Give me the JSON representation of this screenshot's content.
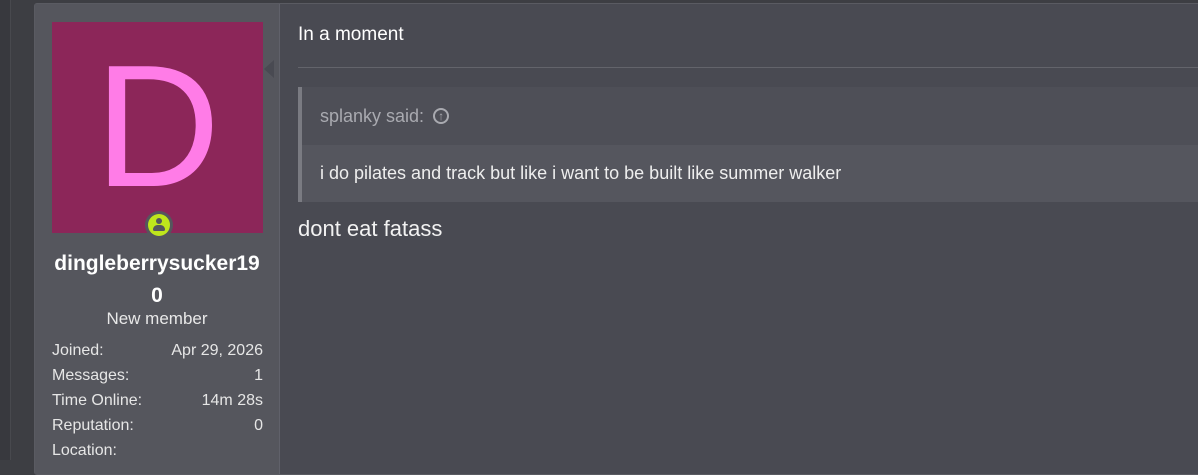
{
  "user": {
    "avatar_letter": "D",
    "username": "dingleberrysucker190",
    "title": "New member",
    "stats": [
      {
        "label": "Joined:",
        "value": "Apr 29, 2026"
      },
      {
        "label": "Messages:",
        "value": "1"
      },
      {
        "label": "Time Online:",
        "value": "14m 28s"
      },
      {
        "label": "Reputation:",
        "value": "0"
      },
      {
        "label": "Location:",
        "value": ""
      }
    ]
  },
  "post": {
    "headline": "In a moment",
    "quote": {
      "author": "splanky said:",
      "text": "i do pilates and track but like i want to be built like summer walker"
    },
    "reply": "dont eat fatass"
  },
  "colors": {
    "avatar_bg": "#8c2659",
    "avatar_letter": "#ff7ce7",
    "online_badge": "#bfe61c"
  },
  "icons": {
    "online": "user-online-icon",
    "quote_jump": "arrow-up-circle-icon"
  }
}
